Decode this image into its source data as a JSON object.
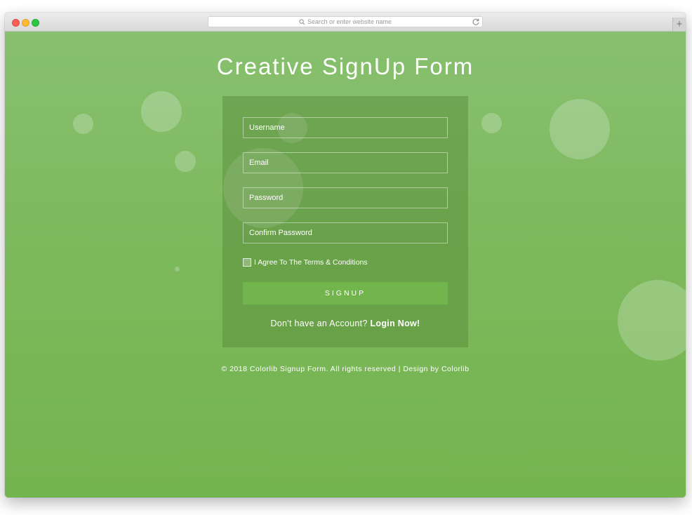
{
  "browser": {
    "address_placeholder": "Search or enter website name",
    "new_tab_label": "+"
  },
  "page": {
    "title": "Creative SignUp Form"
  },
  "form": {
    "username_placeholder": "Username",
    "email_placeholder": "Email",
    "password_placeholder": "Password",
    "confirm_password_placeholder": "Confirm Password",
    "agree_label": "I Agree To The Terms & Conditions",
    "agree_checked": false,
    "signup_label": "SIGNUP",
    "login_prompt": "Don't have an Account?",
    "login_link": "Login Now!"
  },
  "footer": {
    "copyright": "© 2018 Colorlib Signup Form. All rights reserved | Design by",
    "designer_link": "Colorlib"
  },
  "colors": {
    "background": "#7ab855",
    "button": "#72b54c",
    "text": "#ffffff"
  }
}
